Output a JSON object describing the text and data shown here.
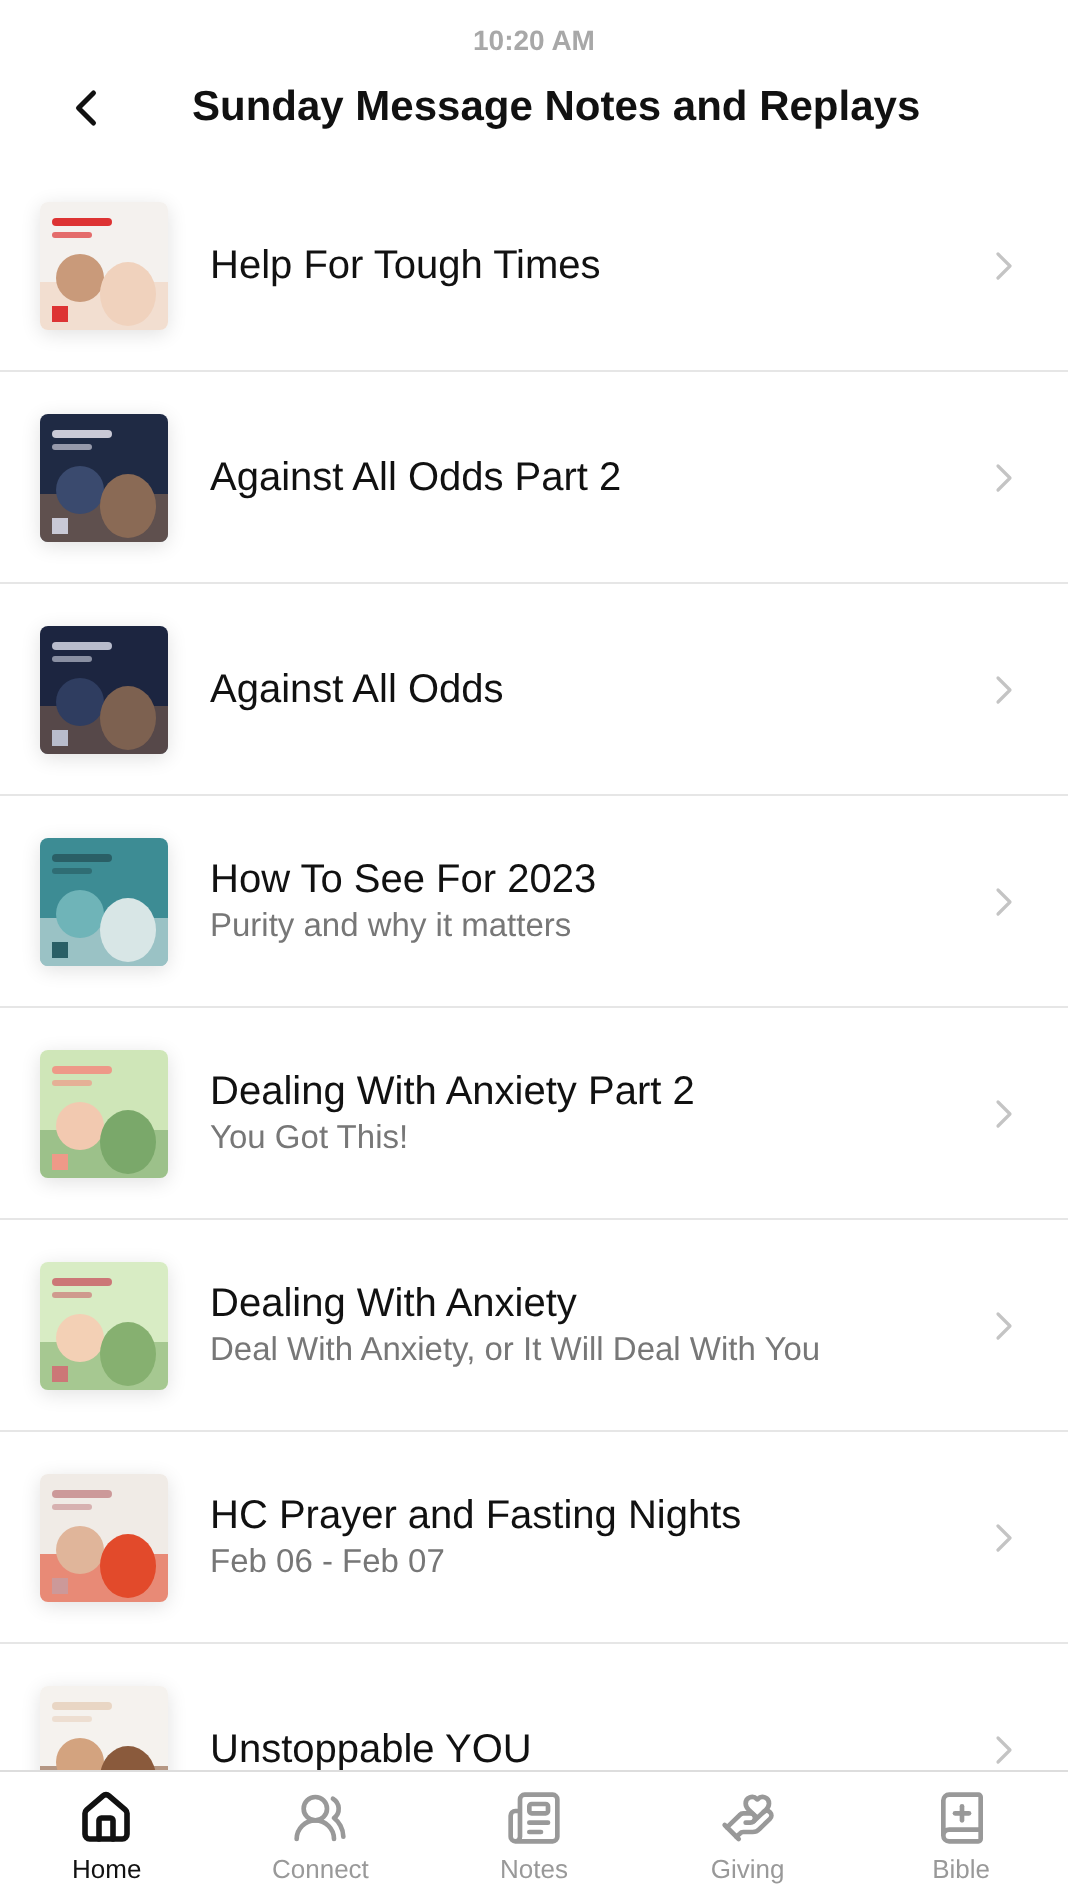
{
  "status_bar": {
    "time": "10:20 AM"
  },
  "header": {
    "title": "Sunday Message Notes and Replays"
  },
  "items": [
    {
      "title": "Help For Tough Times"
    },
    {
      "title": "Against All Odds Part 2"
    },
    {
      "title": "Against All Odds"
    },
    {
      "title": "How To See For 2023",
      "subtitle": "Purity and why it matters"
    },
    {
      "title": "Dealing With Anxiety Part 2",
      "subtitle": "You Got This!"
    },
    {
      "title": "Dealing With Anxiety",
      "subtitle": "Deal With Anxiety, or It Will Deal With You"
    },
    {
      "title": "HC Prayer and Fasting Nights",
      "subtitle": "Feb 06 - Feb 07"
    },
    {
      "title": "Unstoppable YOU"
    }
  ],
  "tab_bar": [
    {
      "label": "Home",
      "selected": true
    },
    {
      "label": "Connect",
      "selected": false
    },
    {
      "label": "Notes",
      "selected": false
    },
    {
      "label": "Giving",
      "selected": false
    },
    {
      "label": "Bible",
      "selected": false
    }
  ]
}
